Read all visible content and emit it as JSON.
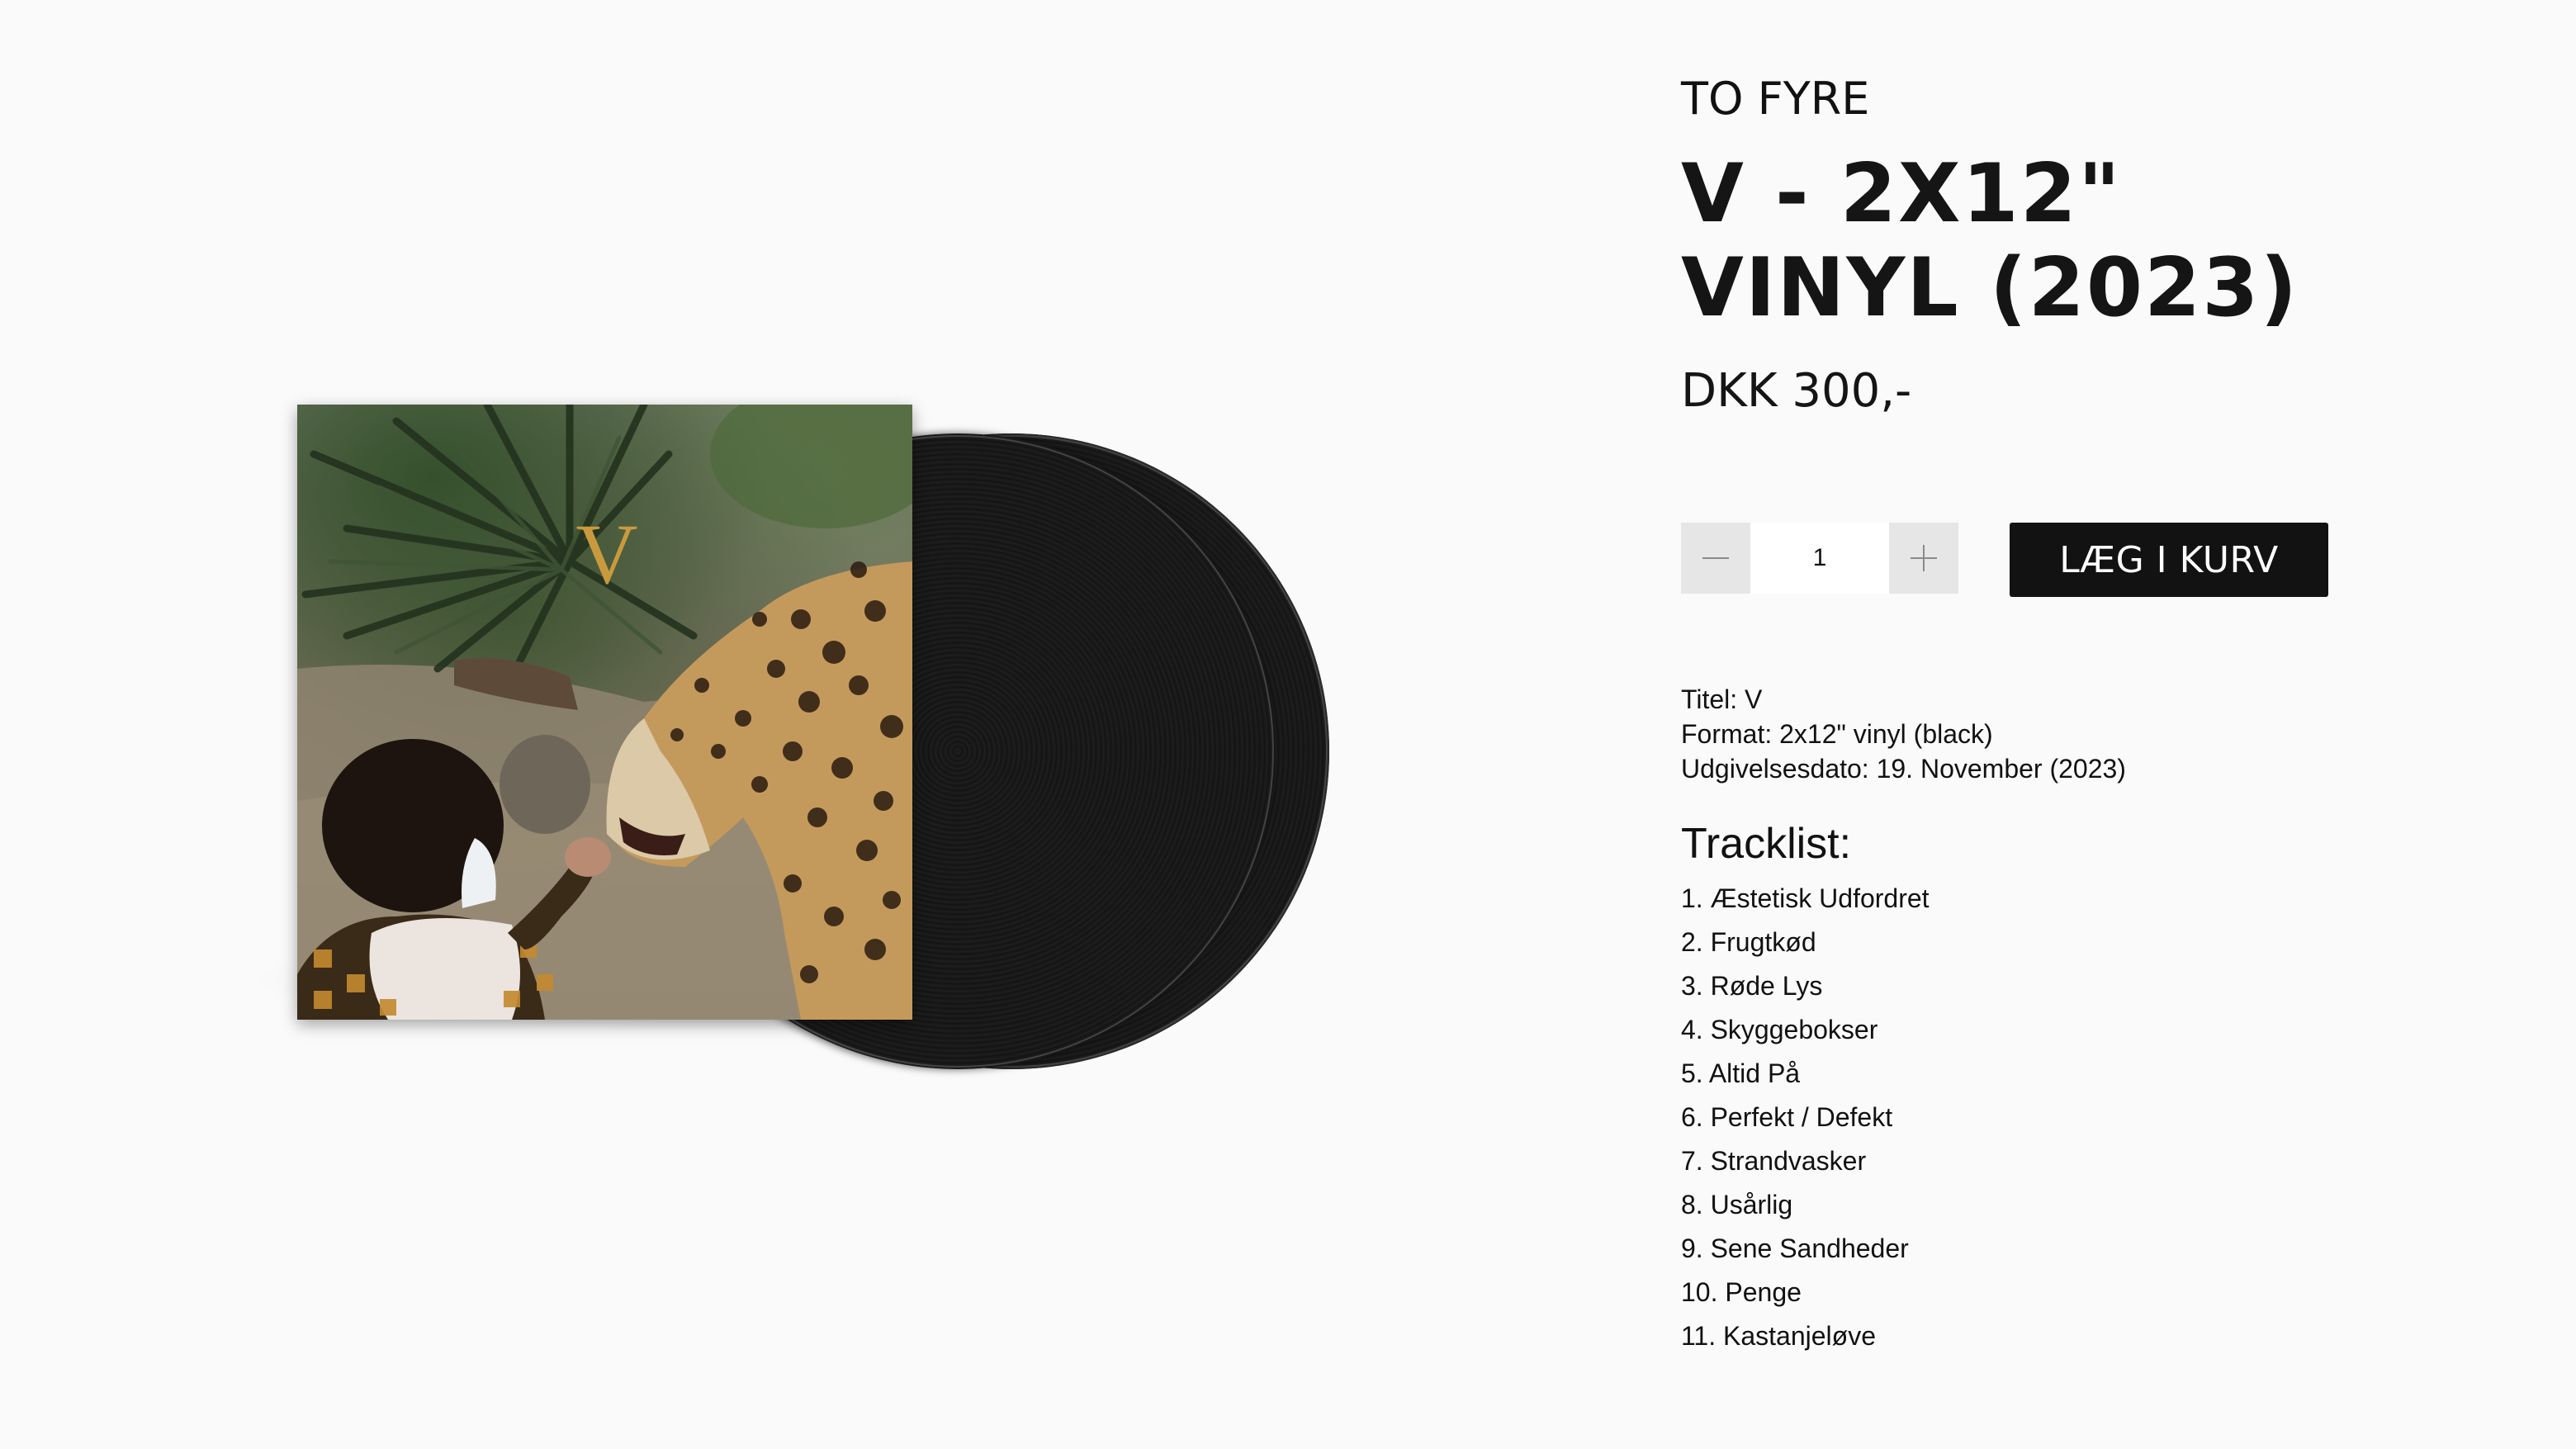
{
  "product": {
    "artist": "TO FYRE",
    "title": "V - 2X12\" VINYL (2023)",
    "price": "DKK 300,-",
    "cover_letter": "V"
  },
  "purchase": {
    "quantity": "1",
    "add_to_cart_label": "LÆG I KURV",
    "decrement_icon": "minus-icon",
    "increment_icon": "plus-icon"
  },
  "details": {
    "titel": "Titel: V",
    "format": "Format: 2x12\" vinyl (black)",
    "release": "Udgivelsesdato: 19. November (2023)"
  },
  "tracklist": {
    "heading": "Tracklist:",
    "tracks": [
      "1. Æstetisk Udfordret",
      "2. Frugtkød",
      "3. Røde Lys",
      "4. Skyggebokser",
      "5. Altid På",
      "6. Perfekt / Defekt",
      "7. Strandvasker",
      "8. Usårlig",
      "9. Sene Sandheder",
      "10. Penge",
      "11. Kastanjeløve"
    ]
  },
  "colors": {
    "background": "#fafafa",
    "button": "#121212",
    "button_text": "#ffffff",
    "qty_button": "#e6e6e6",
    "cover_letter": "#c99a3d"
  }
}
